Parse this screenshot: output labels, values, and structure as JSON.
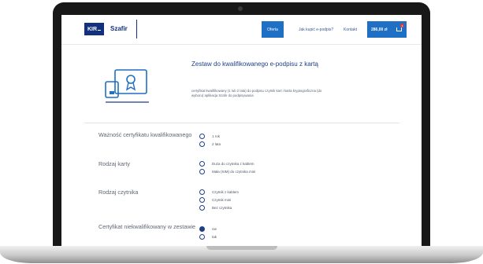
{
  "header": {
    "logo_mark": "KIR",
    "logo_text": "Szafir",
    "nav": [
      {
        "label": "Oferta",
        "active": true
      },
      {
        "label": "Jak kupić e-podpis?",
        "active": false
      },
      {
        "label": "Kontakt",
        "active": false
      }
    ],
    "cart_total": "286,00 zł",
    "cart_count": "1"
  },
  "product": {
    "title": "Zestaw do kwalifikowanego e-podpisu z kartą",
    "description": "certyfikat kwalifikowany (1 lub 2 lata) do podpisu czytnik kart i karta kryptograficzna (do wyboru) aplikacja Szafir do podpisywania",
    "icon": "certificate-card-icon"
  },
  "options": [
    {
      "label": "Ważność certyfikatu kwalifikowanego",
      "choices": [
        {
          "label": "1 rok",
          "checked": false
        },
        {
          "label": "2 lata",
          "checked": false
        }
      ]
    },
    {
      "label": "Rodzaj karty",
      "choices": [
        {
          "label": "Duża do czytnika z kablem",
          "checked": false
        },
        {
          "label": "Mała (SIM) do czytnika mini",
          "checked": false
        }
      ]
    },
    {
      "label": "Rodzaj czytnika",
      "choices": [
        {
          "label": "Czytnik z kablem",
          "checked": false
        },
        {
          "label": "Czytnik mini",
          "checked": false
        },
        {
          "label": "Bez czytnika",
          "checked": false
        }
      ]
    },
    {
      "label": "Certyfikat niekwalifikowany w zestawie",
      "choices": [
        {
          "label": "nie",
          "checked": true
        },
        {
          "label": "tak",
          "checked": false
        }
      ]
    }
  ],
  "colors": {
    "brand": "#11317e",
    "accent": "#1f6fc4",
    "text": "#5f6675"
  }
}
